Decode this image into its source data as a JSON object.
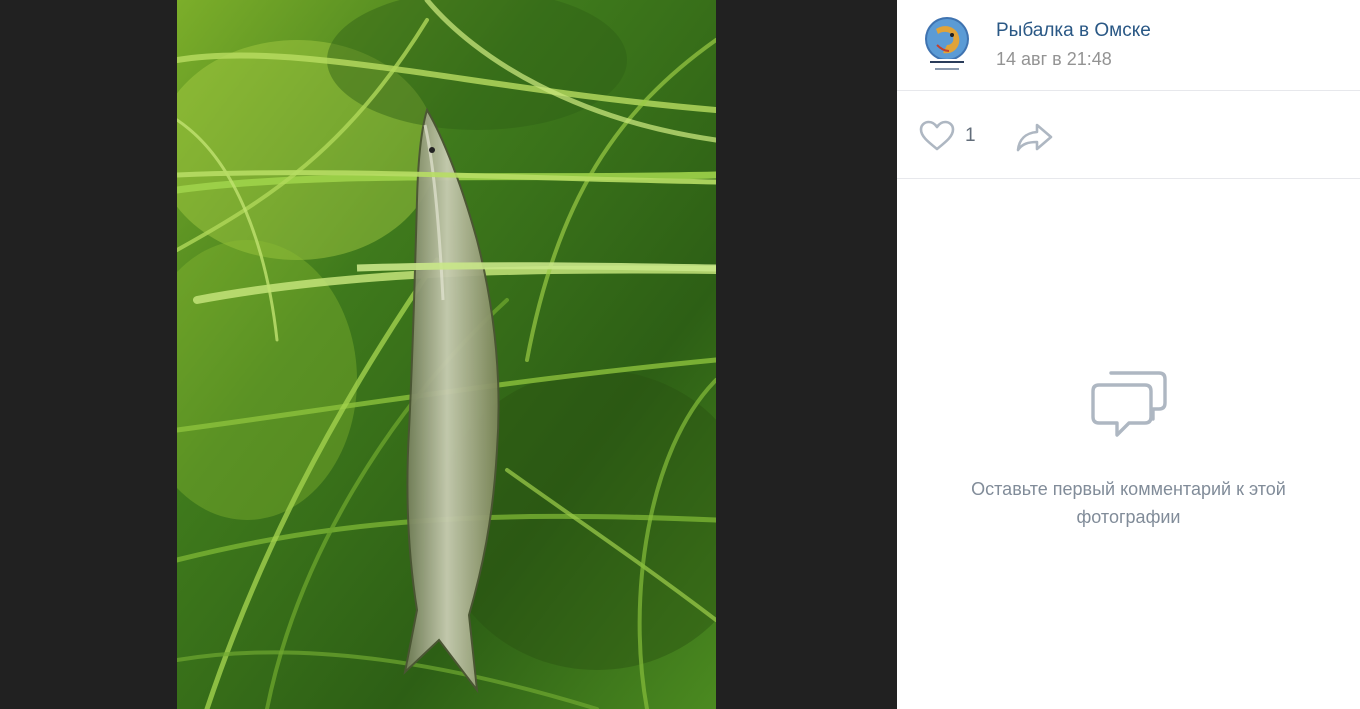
{
  "post": {
    "author": "Рыбалка в Омске",
    "date": "14 авг в 21:48"
  },
  "actions": {
    "like_count": "1"
  },
  "comments": {
    "empty_text": "Оставьте первый комментарий к этой фотографии"
  },
  "icons": {
    "like": "heart-icon",
    "share": "share-arrow-icon",
    "comments_empty": "chat-bubbles-icon"
  },
  "colors": {
    "link": "#2a5885",
    "muted": "#939393",
    "icon": "#aeb7c2",
    "background": "#222222"
  }
}
